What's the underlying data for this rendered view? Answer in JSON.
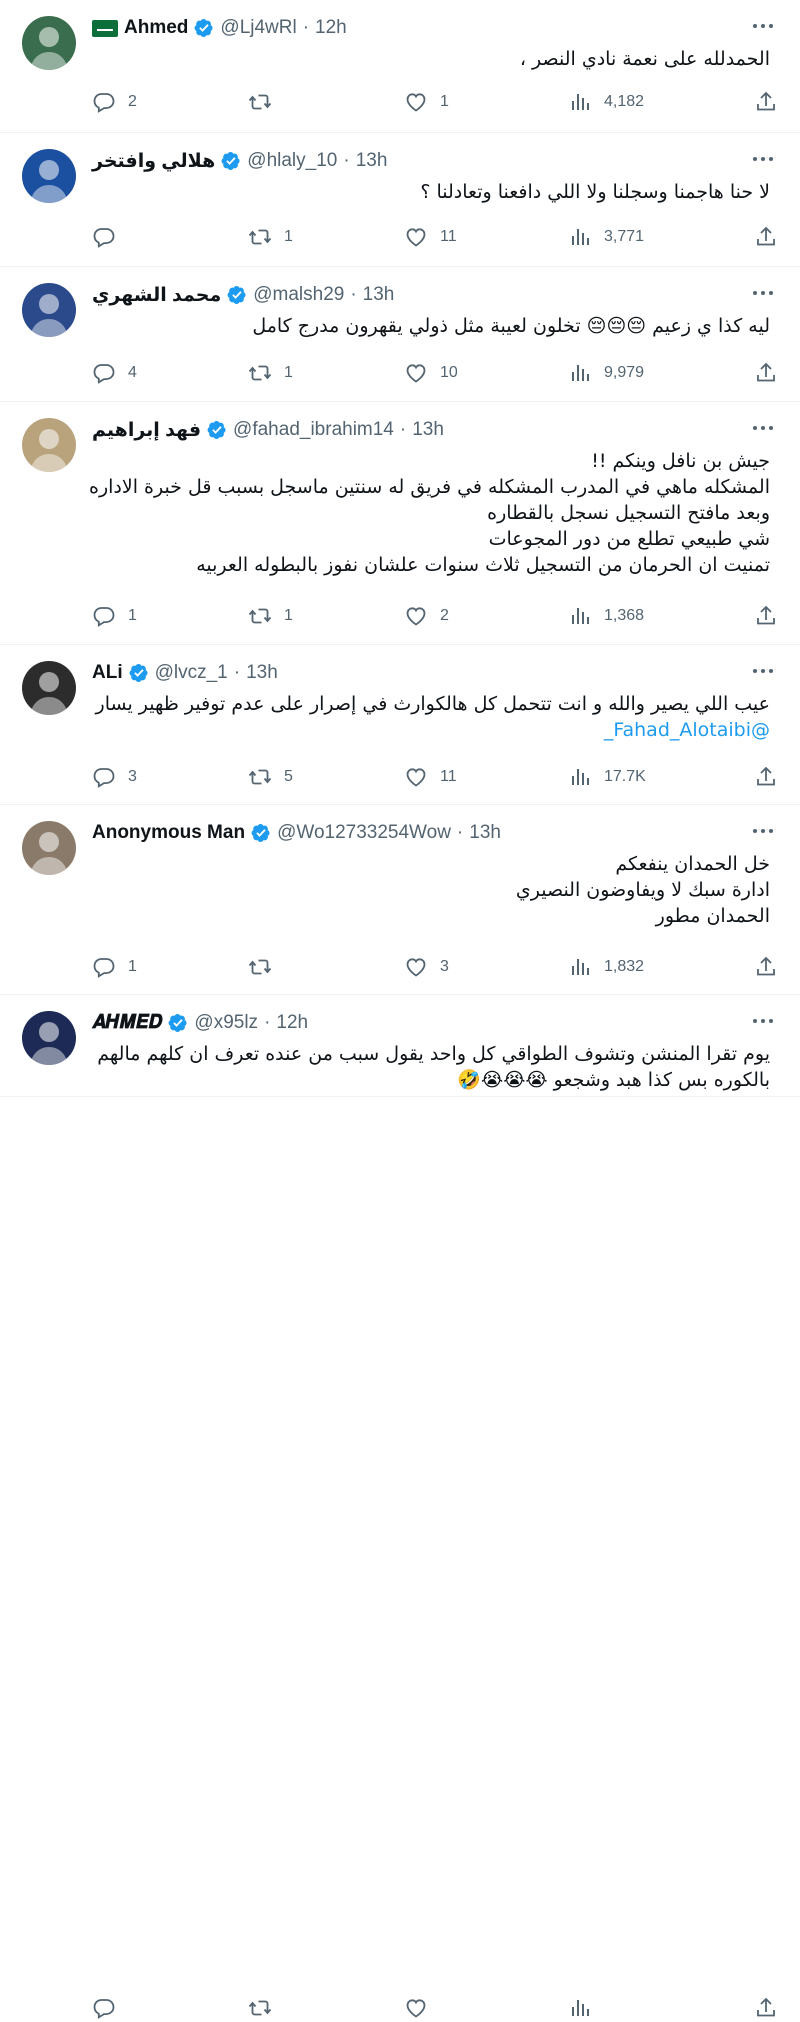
{
  "tweets": [
    {
      "name": "Ahmed",
      "handle": "@Lj4wRl",
      "time": "12h",
      "lines": [
        "الحمدلله على نعمة نادي النصر ،"
      ],
      "reply_count": "2",
      "retweet_count": "",
      "like_count": "1",
      "view_count": "4,182",
      "avatar_color": "#3a6d4d"
    },
    {
      "name": "هلالي وافتخر",
      "handle": "@hlaly_10",
      "time": "13h",
      "lines": [
        "لا حنا هاجمنا وسجلنا ولا اللي دافعنا وتعادلنا ؟"
      ],
      "reply_count": "",
      "retweet_count": "1",
      "like_count": "11",
      "view_count": "3,771",
      "avatar_color": "#1b4fa0"
    },
    {
      "name": "محمد الشهري",
      "handle": "@malsh29",
      "time": "13h",
      "lines": [
        "ليه كذا ي زعيم 😔😔😔 تخلون لعيبة مثل ذولي يقهرون مدرج كامل"
      ],
      "reply_count": "4",
      "retweet_count": "1",
      "like_count": "10",
      "view_count": "9,979",
      "avatar_color": "#2a4a8c"
    },
    {
      "name": "فهد إبراهيم",
      "handle": "@fahad_ibrahim14",
      "time": "13h",
      "lines": [
        "جيش بن نافل وينكم !!",
        "المشكله ماهي في المدرب المشكله في فريق له سنتين ماسجل بسبب قل خبرة الاداره",
        "وبعد مافتح التسجيل نسجل بالقطاره",
        "شي طبيعي تطلع من دور المجوعات",
        "تمنيت ان الحرمان من التسجيل ثلاث سنوات علشان نفوز بالبطوله العربيه"
      ],
      "reply_count": "1",
      "retweet_count": "1",
      "like_count": "2",
      "view_count": "1,368",
      "avatar_color": "#b9a37c"
    },
    {
      "name": "ALi",
      "handle": "@lvcz_1",
      "time": "13h",
      "lines": [
        "عيب اللي يصير والله و انت تتحمل كل هالكوارث في إصرار على عدم توفير ظهير يسار"
      ],
      "mention": "@Fahad_Alotaibi_",
      "reply_count": "3",
      "retweet_count": "5",
      "like_count": "11",
      "view_count": "17.7K",
      "avatar_color": "#2c2c2c"
    },
    {
      "name": "Anonymous Man",
      "handle": "@Wo12733254Wow",
      "time": "13h",
      "lines": [
        "خل الحمدان ينفعكم",
        "ادارة سبك لا ويفاوضون النصيري",
        "الحمدان مطور"
      ],
      "reply_count": "1",
      "retweet_count": "",
      "like_count": "3",
      "view_count": "1,832",
      "avatar_color": "#8a7a6a"
    },
    {
      "name": "𝑨𝑯𝑴𝑬𝑫",
      "handle": "@x95lz",
      "time": "12h",
      "lines": [
        "يوم تقرا المنشن وتشوف الطواقي كل واحد يقول سبب من عنده تعرف ان كلهم مالهم",
        "بالكوره بس كذا هبد وشجعو 😭😭😭🤣"
      ],
      "reply_count": "",
      "retweet_count": "",
      "like_count": "",
      "view_count": "",
      "avatar_color": "#1c2a55"
    }
  ],
  "colors": {
    "accent": "#1d9bf0",
    "muted": "#536471",
    "text": "#0f1419"
  },
  "icons": {
    "reply": "reply-icon",
    "retweet": "retweet-icon",
    "like": "heart-icon",
    "views": "views-icon",
    "share": "share-icon",
    "more": "more-icon",
    "verified": "verified-badge-icon"
  }
}
